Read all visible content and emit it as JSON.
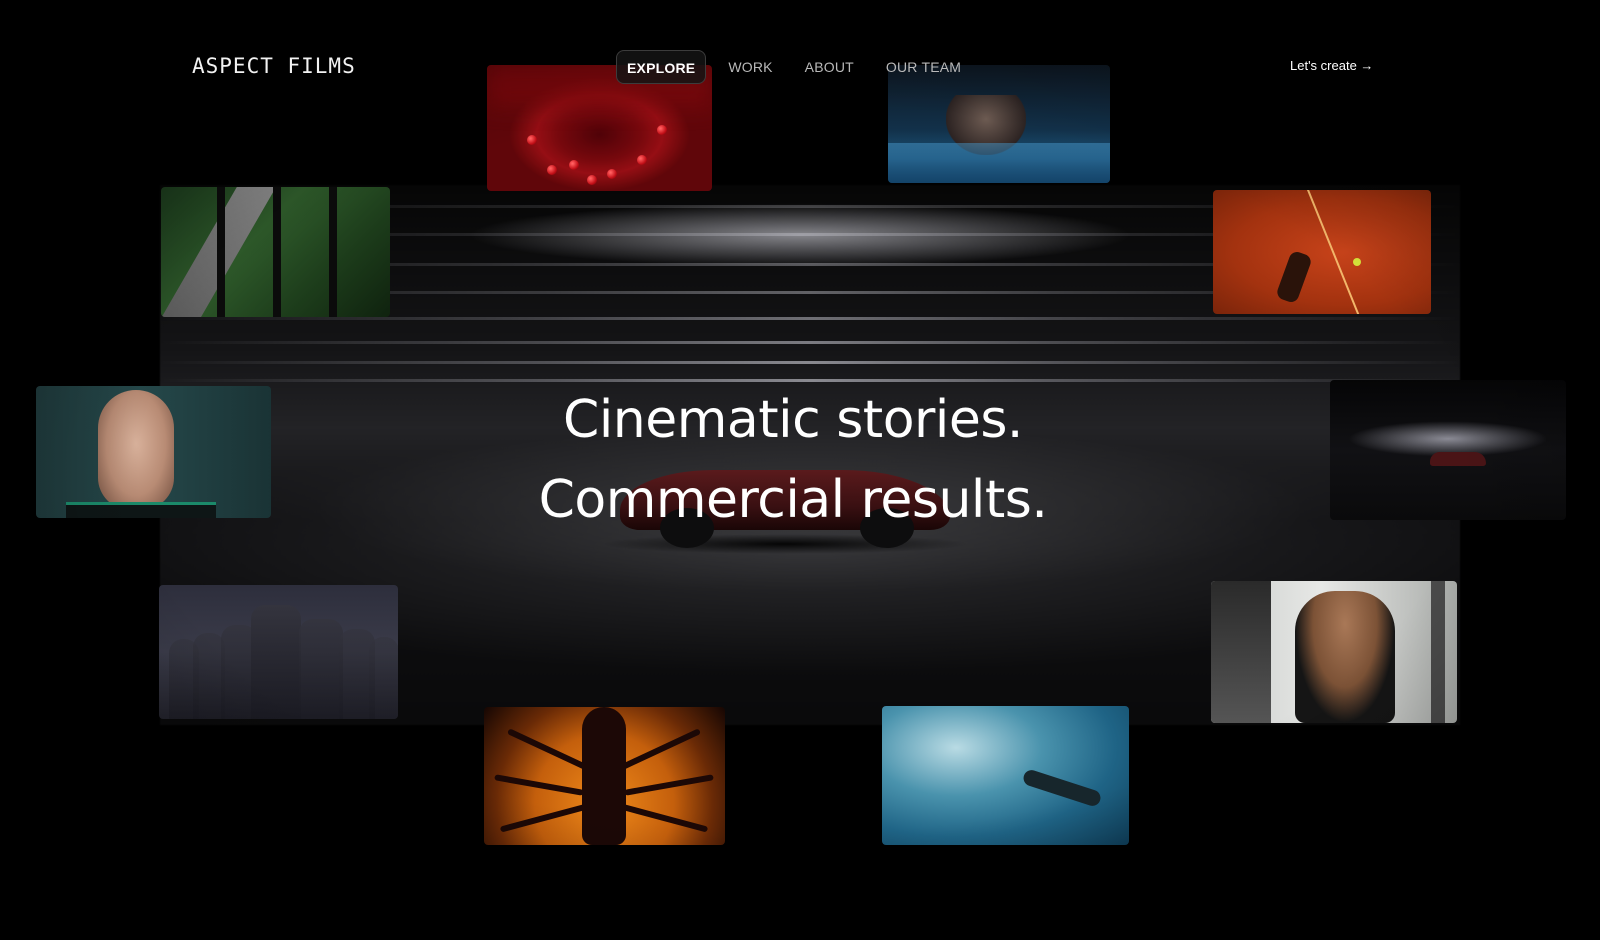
{
  "header": {
    "logo": "ASPECT FILMS",
    "nav": [
      {
        "label": "EXPLORE",
        "active": true
      },
      {
        "label": "WORK",
        "active": false
      },
      {
        "label": "ABOUT",
        "active": false
      },
      {
        "label": "OUR TEAM",
        "active": false
      }
    ],
    "cta": "Let's create →"
  },
  "hero": {
    "line1": "Cinematic stories.",
    "line2": "Commercial results."
  },
  "colors": {
    "background": "#000000",
    "text": "#ffffff",
    "nav_inactive": "#b9b9b9",
    "nav_active_border": "#3c3c3c"
  }
}
